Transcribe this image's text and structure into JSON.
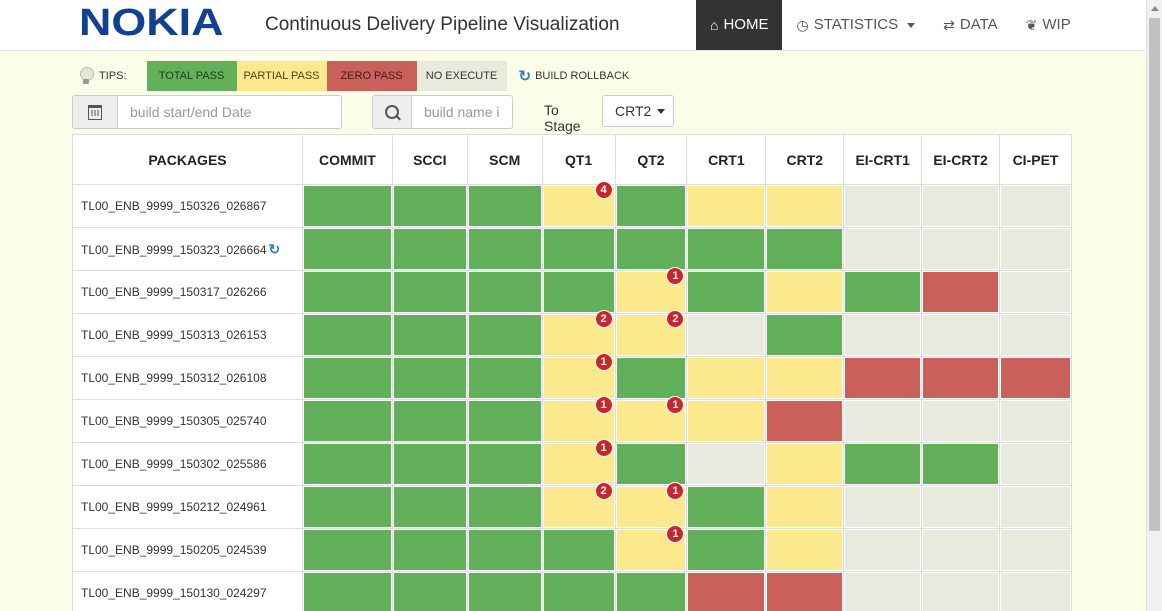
{
  "header": {
    "logo": "NOKIA",
    "title": "Continuous Delivery Pipeline Visualization",
    "nav": [
      {
        "label": "HOME",
        "icon": "home-icon",
        "glyph": "⌂"
      },
      {
        "label": "STATISTICS",
        "icon": "dashboard-icon",
        "glyph": "◷"
      },
      {
        "label": "DATA",
        "icon": "transfer-icon",
        "glyph": "⇄"
      },
      {
        "label": "WIP",
        "icon": "leaf-icon",
        "glyph": "❦"
      }
    ]
  },
  "tips": {
    "label": "TIPS:",
    "legend": {
      "total": "TOTAL PASS",
      "partial": "PARTIAL PASS",
      "zero": "ZERO PASS",
      "none": "NO EXECUTE"
    },
    "rollback": "BUILD ROLLBACK"
  },
  "filters": {
    "date_placeholder": "build start/end Date",
    "name_placeholder": "build name i",
    "stage_label": "To Stage",
    "stage_value": "CRT2"
  },
  "colors": {
    "total": "#63b05a",
    "partial": "#fde98d",
    "zero": "#c9605a",
    "none": "#e8eadd",
    "badge": "#c9262b",
    "brand": "#124191"
  },
  "table": {
    "columns": [
      "PACKAGES",
      "COMMIT",
      "SCCI",
      "SCM",
      "QT1",
      "QT2",
      "CRT1",
      "CRT2",
      "EI-CRT1",
      "EI-CRT2",
      "CI-PET"
    ],
    "rows": [
      {
        "name": "TL00_ENB_9999_150326_026867",
        "rollback": false,
        "cells": [
          {
            "s": "total"
          },
          {
            "s": "total"
          },
          {
            "s": "total"
          },
          {
            "s": "partial",
            "b": "4"
          },
          {
            "s": "total"
          },
          {
            "s": "partial"
          },
          {
            "s": "partial"
          },
          {
            "s": "none"
          },
          {
            "s": "none"
          },
          {
            "s": "none"
          }
        ]
      },
      {
        "name": "TL00_ENB_9999_150323_026664",
        "rollback": true,
        "cells": [
          {
            "s": "total"
          },
          {
            "s": "total"
          },
          {
            "s": "total"
          },
          {
            "s": "total"
          },
          {
            "s": "total"
          },
          {
            "s": "total"
          },
          {
            "s": "total"
          },
          {
            "s": "none"
          },
          {
            "s": "none"
          },
          {
            "s": "none"
          }
        ]
      },
      {
        "name": "TL00_ENB_9999_150317_026266",
        "rollback": false,
        "cells": [
          {
            "s": "total"
          },
          {
            "s": "total"
          },
          {
            "s": "total"
          },
          {
            "s": "total"
          },
          {
            "s": "partial",
            "b": "1"
          },
          {
            "s": "total"
          },
          {
            "s": "partial"
          },
          {
            "s": "total"
          },
          {
            "s": "zero"
          },
          {
            "s": "none"
          }
        ]
      },
      {
        "name": "TL00_ENB_9999_150313_026153",
        "rollback": false,
        "cells": [
          {
            "s": "total"
          },
          {
            "s": "total"
          },
          {
            "s": "total"
          },
          {
            "s": "partial",
            "b": "2"
          },
          {
            "s": "partial",
            "b": "2"
          },
          {
            "s": "none"
          },
          {
            "s": "total"
          },
          {
            "s": "none"
          },
          {
            "s": "none"
          },
          {
            "s": "none"
          }
        ]
      },
      {
        "name": "TL00_ENB_9999_150312_026108",
        "rollback": false,
        "cells": [
          {
            "s": "total"
          },
          {
            "s": "total"
          },
          {
            "s": "total"
          },
          {
            "s": "partial",
            "b": "1"
          },
          {
            "s": "total"
          },
          {
            "s": "partial"
          },
          {
            "s": "partial"
          },
          {
            "s": "zero"
          },
          {
            "s": "zero"
          },
          {
            "s": "zero"
          }
        ]
      },
      {
        "name": "TL00_ENB_9999_150305_025740",
        "rollback": false,
        "cells": [
          {
            "s": "total"
          },
          {
            "s": "total"
          },
          {
            "s": "total"
          },
          {
            "s": "partial",
            "b": "1"
          },
          {
            "s": "partial",
            "b": "1"
          },
          {
            "s": "partial"
          },
          {
            "s": "zero"
          },
          {
            "s": "none"
          },
          {
            "s": "none"
          },
          {
            "s": "none"
          }
        ]
      },
      {
        "name": "TL00_ENB_9999_150302_025586",
        "rollback": false,
        "cells": [
          {
            "s": "total"
          },
          {
            "s": "total"
          },
          {
            "s": "total"
          },
          {
            "s": "partial",
            "b": "1"
          },
          {
            "s": "total"
          },
          {
            "s": "none"
          },
          {
            "s": "partial"
          },
          {
            "s": "total"
          },
          {
            "s": "total"
          },
          {
            "s": "none"
          }
        ]
      },
      {
        "name": "TL00_ENB_9999_150212_024961",
        "rollback": false,
        "cells": [
          {
            "s": "total"
          },
          {
            "s": "total"
          },
          {
            "s": "total"
          },
          {
            "s": "partial",
            "b": "2"
          },
          {
            "s": "partial",
            "b": "1"
          },
          {
            "s": "total"
          },
          {
            "s": "partial"
          },
          {
            "s": "none"
          },
          {
            "s": "none"
          },
          {
            "s": "none"
          }
        ]
      },
      {
        "name": "TL00_ENB_9999_150205_024539",
        "rollback": false,
        "cells": [
          {
            "s": "total"
          },
          {
            "s": "total"
          },
          {
            "s": "total"
          },
          {
            "s": "total"
          },
          {
            "s": "partial",
            "b": "1"
          },
          {
            "s": "total"
          },
          {
            "s": "partial"
          },
          {
            "s": "none"
          },
          {
            "s": "none"
          },
          {
            "s": "none"
          }
        ]
      },
      {
        "name": "TL00_ENB_9999_150130_024297",
        "rollback": false,
        "cells": [
          {
            "s": "total"
          },
          {
            "s": "total"
          },
          {
            "s": "total"
          },
          {
            "s": "total"
          },
          {
            "s": "total"
          },
          {
            "s": "zero"
          },
          {
            "s": "zero"
          },
          {
            "s": "none"
          },
          {
            "s": "none"
          },
          {
            "s": "none"
          }
        ]
      }
    ]
  }
}
